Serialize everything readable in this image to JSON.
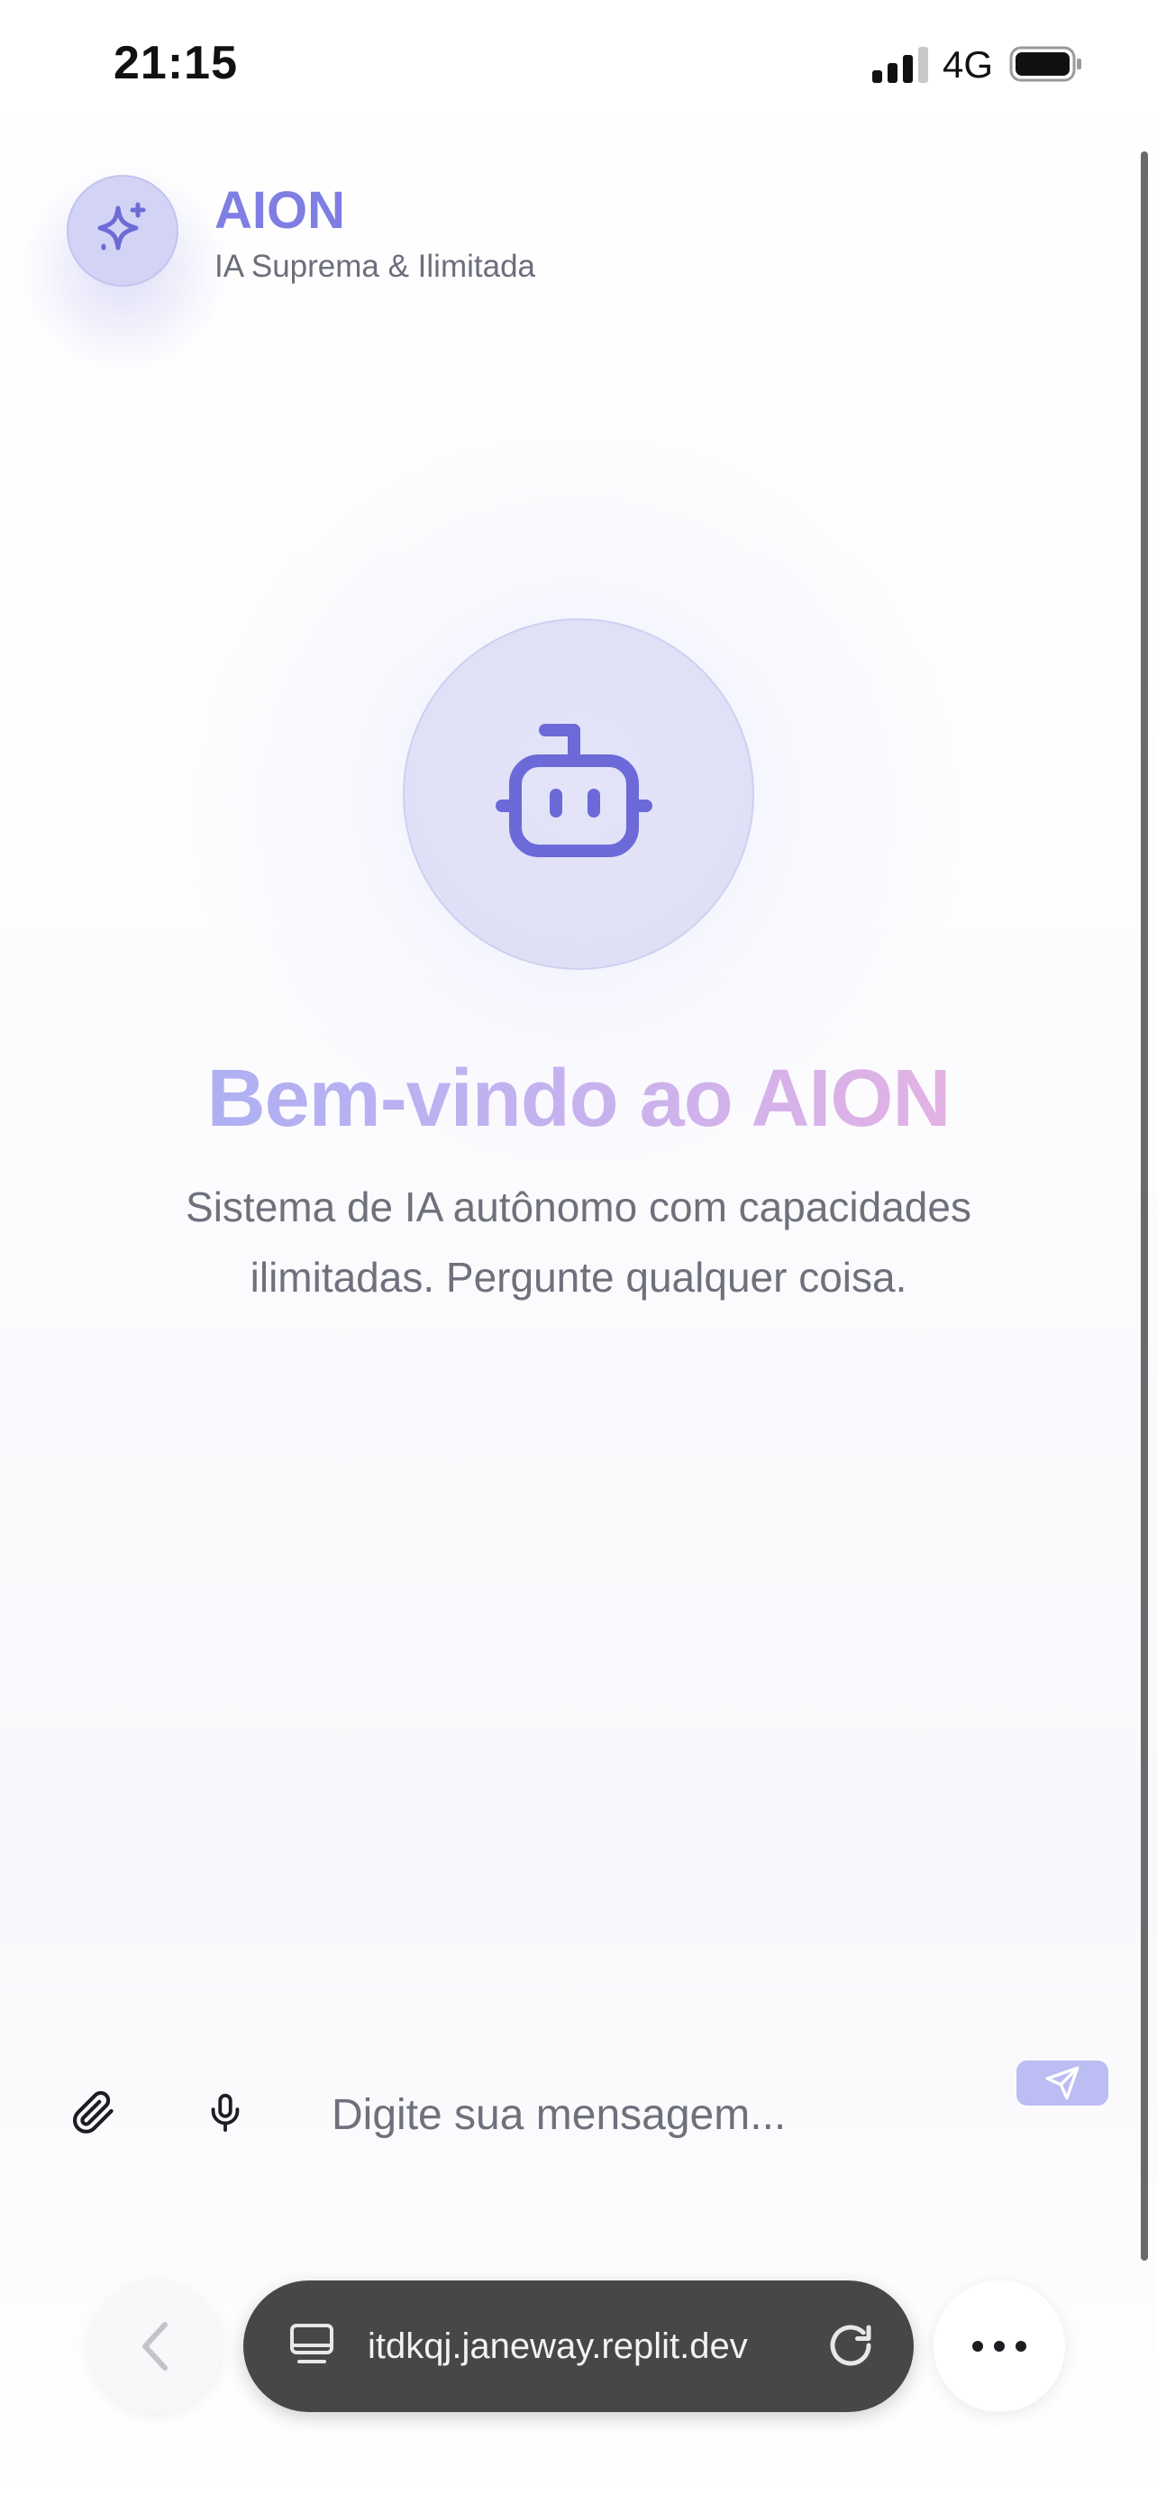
{
  "status_bar": {
    "time": "21:15",
    "network": "4G",
    "signal_icon": "cellular-signal-icon",
    "battery_icon": "battery-icon"
  },
  "header": {
    "logo_icon": "sparkles-icon",
    "title": "AION",
    "subtitle": "IA Suprema & Ilimitada"
  },
  "hero": {
    "icon": "bot-icon",
    "title": "Bem-vindo ao AION",
    "description": "Sistema de IA autônomo com capacidades ilimitadas. Pergunte qualquer coisa."
  },
  "composer": {
    "attach_icon": "paperclip-icon",
    "mic_icon": "microphone-icon",
    "placeholder": "Digite sua mensagem...",
    "send_icon": "send-icon"
  },
  "browser": {
    "back_icon": "chevron-left-icon",
    "tabs_icon": "tabs-icon",
    "url": "itdkqj.janeway.replit.dev",
    "reload_icon": "reload-icon",
    "more_icon": "more-horizontal-icon"
  },
  "colors": {
    "accent": "#7f7ee3",
    "accent_light": "#d3d4f5",
    "gradient_start": "#aeb0f3",
    "gradient_end": "#e3b2e4",
    "muted_text": "#6e717c"
  }
}
